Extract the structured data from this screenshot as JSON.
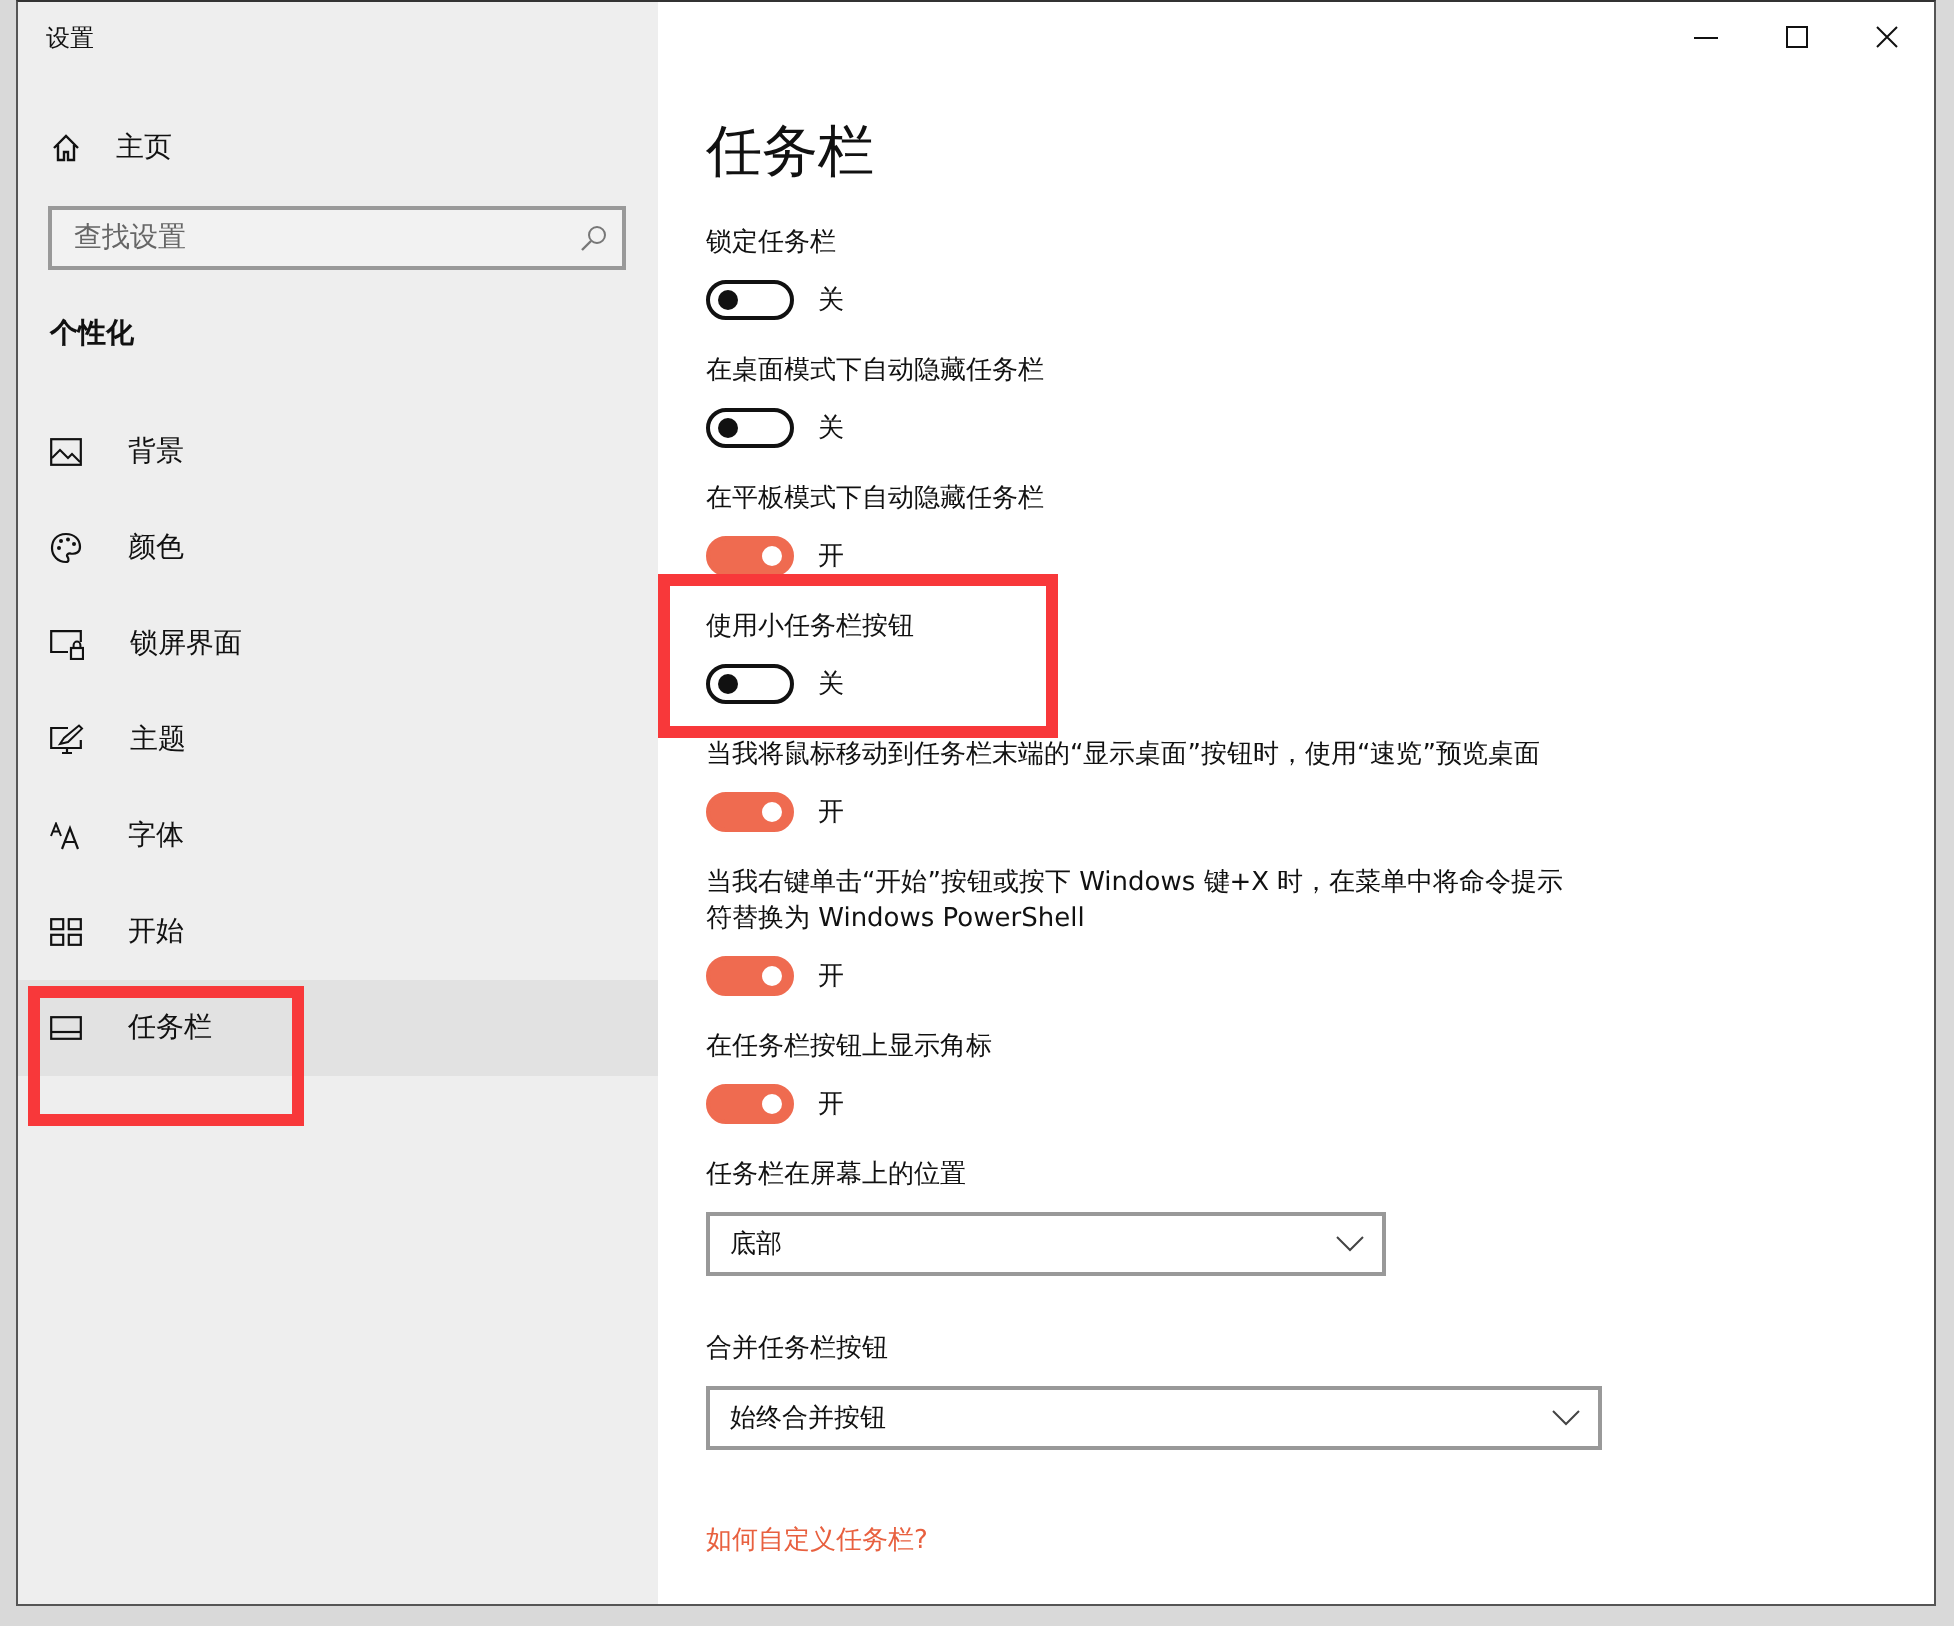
{
  "window": {
    "title": "设置"
  },
  "sidebar": {
    "home": "主页",
    "search": {
      "placeholder": "查找设置"
    },
    "section": "个性化",
    "items": [
      {
        "label": "背景",
        "selected": false,
        "highlighted": false
      },
      {
        "label": "颜色",
        "selected": false,
        "highlighted": false
      },
      {
        "label": "锁屏界面",
        "selected": false,
        "highlighted": false
      },
      {
        "label": "主题",
        "selected": false,
        "highlighted": false
      },
      {
        "label": "字体",
        "selected": false,
        "highlighted": false
      },
      {
        "label": "开始",
        "selected": false,
        "highlighted": false
      },
      {
        "label": "任务栏",
        "selected": true,
        "highlighted": true
      }
    ]
  },
  "page": {
    "title": "任务栏",
    "settings": [
      {
        "kind": "toggle",
        "label": "锁定任务栏",
        "on": false,
        "state": "关",
        "highlighted": false
      },
      {
        "kind": "toggle",
        "label": "在桌面模式下自动隐藏任务栏",
        "on": false,
        "state": "关",
        "highlighted": false
      },
      {
        "kind": "toggle",
        "label": "在平板模式下自动隐藏任务栏",
        "on": true,
        "state": "开",
        "highlighted": false
      },
      {
        "kind": "toggle",
        "label": "使用小任务栏按钮",
        "on": false,
        "state": "关",
        "highlighted": true
      },
      {
        "kind": "toggle",
        "label": "当我将鼠标移动到任务栏末端的“显示桌面”按钮时，使用“速览”预览桌面",
        "on": true,
        "state": "开",
        "highlighted": false
      },
      {
        "kind": "toggle",
        "label": "当我右键单击“开始”按钮或按下 Windows 键+X 时，在菜单中将命令提示符替换为 Windows PowerShell",
        "on": true,
        "state": "开",
        "highlighted": false
      },
      {
        "kind": "toggle",
        "label": "在任务栏按钮上显示角标",
        "on": true,
        "state": "开",
        "highlighted": false
      },
      {
        "kind": "dropdown",
        "label": "任务栏在屏幕上的位置",
        "value": "底部",
        "highlighted": false
      },
      {
        "kind": "dropdown",
        "label": "合并任务栏按钮",
        "value": "始终合并按钮",
        "highlighted": false
      },
      {
        "kind": "link",
        "label": "如何自定义任务栏?",
        "highlighted": false
      }
    ]
  }
}
